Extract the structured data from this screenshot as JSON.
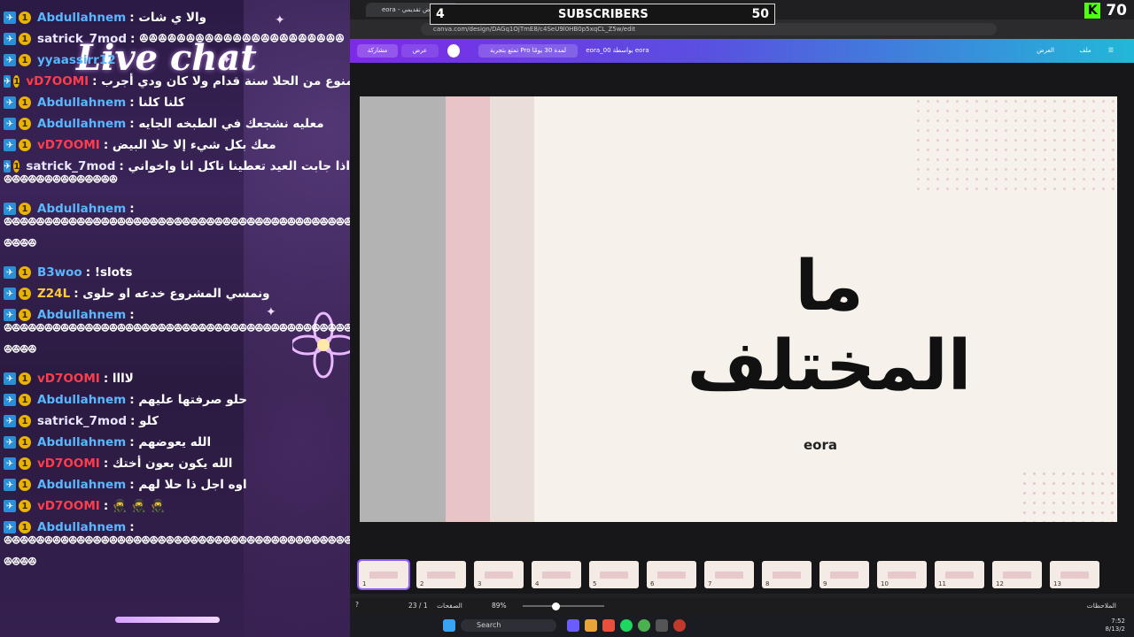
{
  "chat": {
    "title": "Live chat",
    "messages": [
      {
        "user": "Abdullahnem",
        "text": ": والا ي شات",
        "color": "#59b7ff"
      },
      {
        "user": "satrick_7mod",
        "text": ": ꔮꔮꔮꔮꔮꔮꔮꔮꔮꔮꔮꔮꔮꔮꔮꔮꔮꔮꔮꔮꔮꔮ",
        "color": "#eae6ff"
      },
      {
        "user": "yyaassirr12",
        "text": "",
        "color": "#59b7ff"
      },
      {
        "user": "vD7OOMI",
        "text": ": أنا ممنوع من الحلا سنة قدام ولا كان ودي أجرب",
        "color": "#ff3c4c"
      },
      {
        "user": "Abdullahnem",
        "text": ": كلنا كلنا",
        "color": "#59b7ff"
      },
      {
        "user": "Abdullahnem",
        "text": ": معليه نشجعك في الطبخه الجايه",
        "color": "#59b7ff"
      },
      {
        "user": "vD7OOMI",
        "text": ": معك بكل شيء إلا حلا البيض",
        "color": "#ff3c4c"
      },
      {
        "user": "satrick_7mod",
        "text": ": عادي سوي زي اختي اذا جابت العيد تعطينا ناكل انا واخواني",
        "color": "#eae6ff"
      },
      {
        "wrap": "ꔮꔮꔮꔮꔮꔮꔮꔮꔮꔮꔮꔮꔮꔮ"
      },
      {
        "user": "Abdullahnem",
        "text": ":",
        "color": "#59b7ff"
      },
      {
        "wrap": "ꔮꔮꔮꔮꔮꔮꔮꔮꔮꔮꔮꔮꔮꔮꔮꔮꔮꔮꔮꔮꔮꔮꔮꔮꔮꔮꔮꔮꔮꔮꔮꔮꔮꔮꔮꔮꔮꔮꔮꔮꔮꔮꔮꔮꔮꔮꔮꔮꔮꔮꔮꔮꔮꔮꔮꔮꔮꔮꔮꔮ"
      },
      {
        "wrap": "ꔮꔮꔮꔮ"
      },
      {
        "user": "B3woo",
        "text": ": !slots",
        "color": "#59b7ff"
      },
      {
        "user": "Z24L",
        "text": ": ونمسي المشروع خدعه او حلوى",
        "color": "#ffcb3c"
      },
      {
        "user": "Abdullahnem",
        "text": ":",
        "color": "#59b7ff"
      },
      {
        "wrap": "ꔮꔮꔮꔮꔮꔮꔮꔮꔮꔮꔮꔮꔮꔮꔮꔮꔮꔮꔮꔮꔮꔮꔮꔮꔮꔮꔮꔮꔮꔮꔮꔮꔮꔮꔮꔮꔮꔮꔮꔮꔮꔮꔮꔮꔮꔮꔮꔮꔮꔮꔮꔮꔮꔮꔮꔮꔮꔮꔮꔮ"
      },
      {
        "wrap": "ꔮꔮꔮꔮ"
      },
      {
        "user": "vD7OOMI",
        "text": ": لاااا",
        "color": "#ff3c4c"
      },
      {
        "user": "Abdullahnem",
        "text": ": حلو صرفتها عليهم",
        "color": "#59b7ff"
      },
      {
        "user": "satrick_7mod",
        "text": ": كلو",
        "color": "#eae6ff"
      },
      {
        "user": "Abdullahnem",
        "text": ": الله يعوضهم",
        "color": "#59b7ff"
      },
      {
        "user": "vD7OOMI",
        "text": ": الله يكون بعون أختك",
        "color": "#ff3c4c"
      },
      {
        "user": "Abdullahnem",
        "text": ": اوه اجل ذا حلا لهم",
        "color": "#59b7ff"
      },
      {
        "user": "vD7OOMI",
        "text": ": 🥷 🥷 🥷",
        "color": "#ff3c4c"
      },
      {
        "user": "Abdullahnem",
        "text": ":",
        "color": "#59b7ff"
      },
      {
        "wrap": "ꔮꔮꔮꔮꔮꔮꔮꔮꔮꔮꔮꔮꔮꔮꔮꔮꔮꔮꔮꔮꔮꔮꔮꔮꔮꔮꔮꔮꔮꔮꔮꔮꔮꔮꔮꔮꔮꔮꔮꔮꔮꔮꔮꔮꔮꔮꔮꔮꔮꔮꔮꔮꔮꔮꔮꔮꔮꔮꔮꔮ"
      },
      {
        "wrap": "ꔮꔮꔮꔮ"
      }
    ]
  },
  "overlay": {
    "left_number": "4",
    "label": "SUBSCRIBERS",
    "right_number": "50",
    "kick_logo": "K",
    "kick_count": "70"
  },
  "browser": {
    "tab_title": "eora - عرض تقديمي",
    "url": "canva.com/design/DAGq1OjTmE8/c4SeU9l0HB0p5xqCL_Z5w/edit"
  },
  "canva": {
    "file_label": "ملف",
    "present_label": "العرض",
    "project_name": "eora_00 بواسطة eora",
    "pro_trial": "تمتع بتجربة Pro لمدة 30 يومًا",
    "view_label": "عرض",
    "share_label": "مشاركة"
  },
  "slide": {
    "title": "ما المختلف",
    "subtitle": "eora"
  },
  "thumbnails": [
    "1",
    "2",
    "3",
    "4",
    "5",
    "6",
    "7",
    "8",
    "9",
    "10",
    "11",
    "12",
    "13"
  ],
  "statusbar": {
    "zoom": "89%",
    "pages": "23 / 1",
    "pages_label": "الصفحات",
    "notes_label": "الملاحظات"
  },
  "taskbar": {
    "search": "Search",
    "time": "7:52",
    "date": "8/13/2"
  },
  "icons": [
    "mod-badge-icon",
    "coin-badge-icon",
    "crown-badge-icon",
    "vip-badge-icon",
    "kick-logo-icon",
    "windows-start-icon",
    "search-icon"
  ]
}
